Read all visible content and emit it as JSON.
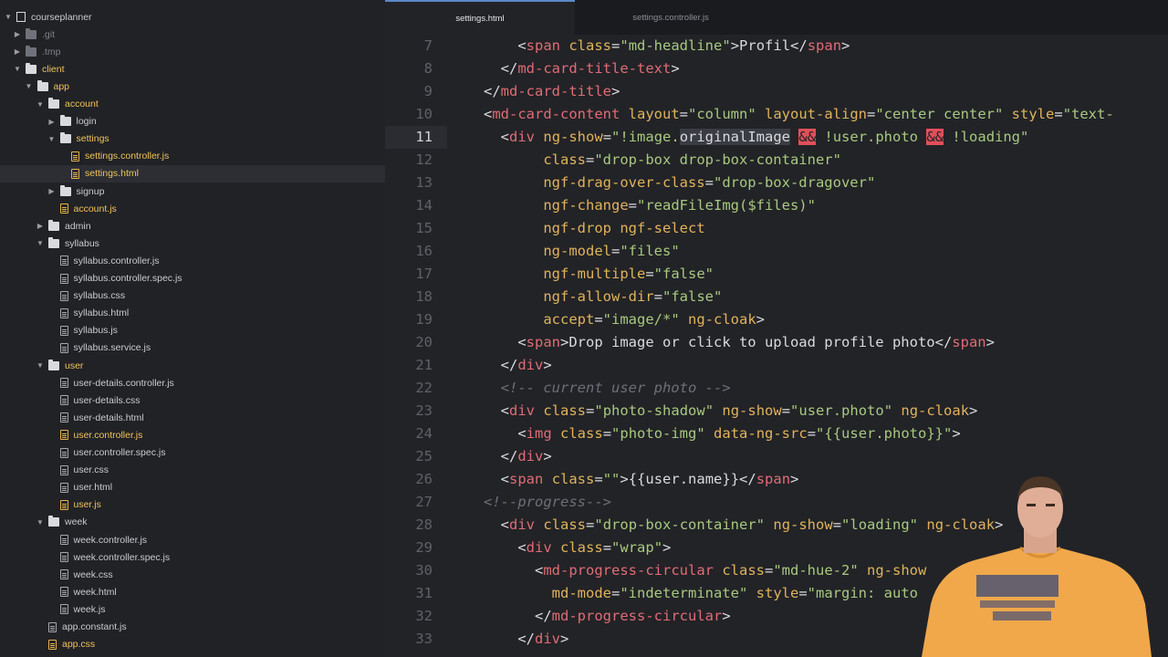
{
  "sidebar": {
    "items": [
      {
        "label": "courseplanner",
        "type": "repo",
        "depth": 0,
        "chev": "down",
        "hl": false,
        "dim": false
      },
      {
        "label": ".git",
        "type": "folder",
        "depth": 1,
        "chev": "right",
        "hl": false,
        "dim": true
      },
      {
        "label": ".tmp",
        "type": "folder",
        "depth": 1,
        "chev": "right",
        "hl": false,
        "dim": true
      },
      {
        "label": "client",
        "type": "folder",
        "depth": 1,
        "chev": "down",
        "hl": true,
        "dim": false
      },
      {
        "label": "app",
        "type": "folder",
        "depth": 2,
        "chev": "down",
        "hl": true,
        "dim": false
      },
      {
        "label": "account",
        "type": "folder",
        "depth": 3,
        "chev": "down",
        "hl": true,
        "dim": false
      },
      {
        "label": "login",
        "type": "folder",
        "depth": 4,
        "chev": "right",
        "hl": false,
        "dim": false
      },
      {
        "label": "settings",
        "type": "folder",
        "depth": 4,
        "chev": "down",
        "hl": true,
        "dim": false
      },
      {
        "label": "settings.controller.js",
        "type": "file",
        "depth": 5,
        "chev": "",
        "hl": true,
        "dim": false
      },
      {
        "label": "settings.html",
        "type": "file",
        "depth": 5,
        "chev": "",
        "hl": true,
        "dim": false,
        "selected": true
      },
      {
        "label": "signup",
        "type": "folder",
        "depth": 4,
        "chev": "right",
        "hl": false,
        "dim": false
      },
      {
        "label": "account.js",
        "type": "file",
        "depth": 4,
        "chev": "",
        "hl": true,
        "dim": false
      },
      {
        "label": "admin",
        "type": "folder",
        "depth": 3,
        "chev": "right",
        "hl": false,
        "dim": false
      },
      {
        "label": "syllabus",
        "type": "folder",
        "depth": 3,
        "chev": "down",
        "hl": false,
        "dim": false
      },
      {
        "label": "syllabus.controller.js",
        "type": "file",
        "depth": 4,
        "chev": "",
        "hl": false,
        "dim": false
      },
      {
        "label": "syllabus.controller.spec.js",
        "type": "file",
        "depth": 4,
        "chev": "",
        "hl": false,
        "dim": false
      },
      {
        "label": "syllabus.css",
        "type": "file",
        "depth": 4,
        "chev": "",
        "hl": false,
        "dim": false
      },
      {
        "label": "syllabus.html",
        "type": "file",
        "depth": 4,
        "chev": "",
        "hl": false,
        "dim": false
      },
      {
        "label": "syllabus.js",
        "type": "file",
        "depth": 4,
        "chev": "",
        "hl": false,
        "dim": false
      },
      {
        "label": "syllabus.service.js",
        "type": "file",
        "depth": 4,
        "chev": "",
        "hl": false,
        "dim": false
      },
      {
        "label": "user",
        "type": "folder",
        "depth": 3,
        "chev": "down",
        "hl": true,
        "dim": false
      },
      {
        "label": "user-details.controller.js",
        "type": "file",
        "depth": 4,
        "chev": "",
        "hl": false,
        "dim": false
      },
      {
        "label": "user-details.css",
        "type": "file",
        "depth": 4,
        "chev": "",
        "hl": false,
        "dim": false
      },
      {
        "label": "user-details.html",
        "type": "file",
        "depth": 4,
        "chev": "",
        "hl": false,
        "dim": false
      },
      {
        "label": "user.controller.js",
        "type": "file",
        "depth": 4,
        "chev": "",
        "hl": true,
        "dim": false
      },
      {
        "label": "user.controller.spec.js",
        "type": "file",
        "depth": 4,
        "chev": "",
        "hl": false,
        "dim": false
      },
      {
        "label": "user.css",
        "type": "file",
        "depth": 4,
        "chev": "",
        "hl": false,
        "dim": false
      },
      {
        "label": "user.html",
        "type": "file",
        "depth": 4,
        "chev": "",
        "hl": false,
        "dim": false
      },
      {
        "label": "user.js",
        "type": "file",
        "depth": 4,
        "chev": "",
        "hl": true,
        "dim": false
      },
      {
        "label": "week",
        "type": "folder",
        "depth": 3,
        "chev": "down",
        "hl": false,
        "dim": false
      },
      {
        "label": "week.controller.js",
        "type": "file",
        "depth": 4,
        "chev": "",
        "hl": false,
        "dim": false
      },
      {
        "label": "week.controller.spec.js",
        "type": "file",
        "depth": 4,
        "chev": "",
        "hl": false,
        "dim": false
      },
      {
        "label": "week.css",
        "type": "file",
        "depth": 4,
        "chev": "",
        "hl": false,
        "dim": false
      },
      {
        "label": "week.html",
        "type": "file",
        "depth": 4,
        "chev": "",
        "hl": false,
        "dim": false
      },
      {
        "label": "week.js",
        "type": "file",
        "depth": 4,
        "chev": "",
        "hl": false,
        "dim": false
      },
      {
        "label": "app.constant.js",
        "type": "file",
        "depth": 3,
        "chev": "",
        "hl": false,
        "dim": false
      },
      {
        "label": "app.css",
        "type": "file",
        "depth": 3,
        "chev": "",
        "hl": true,
        "dim": false
      }
    ]
  },
  "tabs": [
    {
      "label": "settings.html",
      "active": true
    },
    {
      "label": "settings.controller.js",
      "active": false
    }
  ],
  "editor": {
    "current_line": 11,
    "lines": [
      {
        "num": "7",
        "tokens": [
          [
            "t",
            "    "
          ],
          [
            "p",
            "<"
          ],
          [
            "g",
            "span"
          ],
          [
            "t",
            " "
          ],
          [
            "a",
            "class"
          ],
          [
            "p",
            "="
          ],
          [
            "s",
            "\"md-headline\""
          ],
          [
            "p",
            ">"
          ],
          [
            "t",
            "Profil"
          ],
          [
            "p",
            "</"
          ],
          [
            "g",
            "span"
          ],
          [
            "p",
            ">"
          ]
        ]
      },
      {
        "num": "8",
        "tokens": [
          [
            "t",
            "  "
          ],
          [
            "p",
            "</"
          ],
          [
            "g",
            "md-card-title-text"
          ],
          [
            "p",
            ">"
          ]
        ]
      },
      {
        "num": "9",
        "tokens": [
          [
            "p",
            "</"
          ],
          [
            "g",
            "md-card-title"
          ],
          [
            "p",
            ">"
          ]
        ]
      },
      {
        "num": "10",
        "tokens": [
          [
            "p",
            "<"
          ],
          [
            "g",
            "md-card-content"
          ],
          [
            "t",
            " "
          ],
          [
            "a",
            "layout"
          ],
          [
            "p",
            "="
          ],
          [
            "s",
            "\"column\""
          ],
          [
            "t",
            " "
          ],
          [
            "a",
            "layout-align"
          ],
          [
            "p",
            "="
          ],
          [
            "s",
            "\"center center\""
          ],
          [
            "t",
            " "
          ],
          [
            "a",
            "style"
          ],
          [
            "p",
            "="
          ],
          [
            "s",
            "\"text-"
          ]
        ]
      },
      {
        "num": "11",
        "tokens": [
          [
            "t",
            "  "
          ],
          [
            "p",
            "<"
          ],
          [
            "g",
            "div"
          ],
          [
            "t",
            " "
          ],
          [
            "a",
            "ng-show"
          ],
          [
            "p",
            "="
          ],
          [
            "s",
            "\"!image."
          ],
          [
            "sel",
            "originalImage"
          ],
          [
            "t",
            " "
          ],
          [
            "amp",
            "&&"
          ],
          [
            "s",
            " !user.photo "
          ],
          [
            "amp",
            "&&"
          ],
          [
            "s",
            " !loading\""
          ]
        ]
      },
      {
        "num": "12",
        "tokens": [
          [
            "t",
            "       "
          ],
          [
            "a",
            "class"
          ],
          [
            "p",
            "="
          ],
          [
            "s",
            "\"drop-box drop-box-container\""
          ]
        ]
      },
      {
        "num": "13",
        "tokens": [
          [
            "t",
            "       "
          ],
          [
            "a",
            "ngf-drag-over-class"
          ],
          [
            "p",
            "="
          ],
          [
            "s",
            "\"drop-box-dragover\""
          ]
        ]
      },
      {
        "num": "14",
        "tokens": [
          [
            "t",
            "       "
          ],
          [
            "a",
            "ngf-change"
          ],
          [
            "p",
            "="
          ],
          [
            "s",
            "\"readFileImg($files)\""
          ]
        ]
      },
      {
        "num": "15",
        "tokens": [
          [
            "t",
            "       "
          ],
          [
            "a",
            "ngf-drop ngf-select"
          ]
        ]
      },
      {
        "num": "16",
        "tokens": [
          [
            "t",
            "       "
          ],
          [
            "a",
            "ng-model"
          ],
          [
            "p",
            "="
          ],
          [
            "s",
            "\"files\""
          ]
        ]
      },
      {
        "num": "17",
        "tokens": [
          [
            "t",
            "       "
          ],
          [
            "a",
            "ngf-multiple"
          ],
          [
            "p",
            "="
          ],
          [
            "s",
            "\"false\""
          ]
        ]
      },
      {
        "num": "18",
        "tokens": [
          [
            "t",
            "       "
          ],
          [
            "a",
            "ngf-allow-dir"
          ],
          [
            "p",
            "="
          ],
          [
            "s",
            "\"false\""
          ]
        ]
      },
      {
        "num": "19",
        "tokens": [
          [
            "t",
            "       "
          ],
          [
            "a",
            "accept"
          ],
          [
            "p",
            "="
          ],
          [
            "s",
            "\"image/*\""
          ],
          [
            "t",
            " "
          ],
          [
            "a",
            "ng-cloak"
          ],
          [
            "p",
            ">"
          ]
        ]
      },
      {
        "num": "20",
        "tokens": [
          [
            "t",
            "    "
          ],
          [
            "p",
            "<"
          ],
          [
            "g",
            "span"
          ],
          [
            "p",
            ">"
          ],
          [
            "t",
            "Drop image or click to upload profile photo"
          ],
          [
            "p",
            "</"
          ],
          [
            "g",
            "span"
          ],
          [
            "p",
            ">"
          ]
        ]
      },
      {
        "num": "21",
        "tokens": [
          [
            "t",
            "  "
          ],
          [
            "p",
            "</"
          ],
          [
            "g",
            "div"
          ],
          [
            "p",
            ">"
          ]
        ]
      },
      {
        "num": "22",
        "tokens": [
          [
            "t",
            "  "
          ],
          [
            "c",
            "<!-- current user photo -->"
          ]
        ]
      },
      {
        "num": "23",
        "tokens": [
          [
            "t",
            "  "
          ],
          [
            "p",
            "<"
          ],
          [
            "g",
            "div"
          ],
          [
            "t",
            " "
          ],
          [
            "a",
            "class"
          ],
          [
            "p",
            "="
          ],
          [
            "s",
            "\"photo-shadow\""
          ],
          [
            "t",
            " "
          ],
          [
            "a",
            "ng-show"
          ],
          [
            "p",
            "="
          ],
          [
            "s",
            "\"user.photo\""
          ],
          [
            "t",
            " "
          ],
          [
            "a",
            "ng-cloak"
          ],
          [
            "p",
            ">"
          ]
        ]
      },
      {
        "num": "24",
        "tokens": [
          [
            "t",
            "    "
          ],
          [
            "p",
            "<"
          ],
          [
            "g",
            "img"
          ],
          [
            "t",
            " "
          ],
          [
            "a",
            "class"
          ],
          [
            "p",
            "="
          ],
          [
            "s",
            "\"photo-img\""
          ],
          [
            "t",
            " "
          ],
          [
            "a",
            "data-ng-src"
          ],
          [
            "p",
            "="
          ],
          [
            "s",
            "\"{{user.photo}}\""
          ],
          [
            "p",
            ">"
          ]
        ]
      },
      {
        "num": "25",
        "tokens": [
          [
            "t",
            "  "
          ],
          [
            "p",
            "</"
          ],
          [
            "g",
            "div"
          ],
          [
            "p",
            ">"
          ]
        ]
      },
      {
        "num": "26",
        "tokens": [
          [
            "t",
            "  "
          ],
          [
            "p",
            "<"
          ],
          [
            "g",
            "span"
          ],
          [
            "t",
            " "
          ],
          [
            "a",
            "class"
          ],
          [
            "p",
            "="
          ],
          [
            "s",
            "\"\""
          ],
          [
            "p",
            ">"
          ],
          [
            "t",
            "{{user.name}}"
          ],
          [
            "p",
            "</"
          ],
          [
            "g",
            "span"
          ],
          [
            "p",
            ">"
          ]
        ]
      },
      {
        "num": "27",
        "tokens": [
          [
            "c",
            "<!--progress-->"
          ]
        ]
      },
      {
        "num": "28",
        "tokens": [
          [
            "t",
            "  "
          ],
          [
            "p",
            "<"
          ],
          [
            "g",
            "div"
          ],
          [
            "t",
            " "
          ],
          [
            "a",
            "class"
          ],
          [
            "p",
            "="
          ],
          [
            "s",
            "\"drop-box-container\""
          ],
          [
            "t",
            " "
          ],
          [
            "a",
            "ng-show"
          ],
          [
            "p",
            "="
          ],
          [
            "s",
            "\"loading\""
          ],
          [
            "t",
            " "
          ],
          [
            "a",
            "ng-cloak"
          ],
          [
            "p",
            ">"
          ]
        ]
      },
      {
        "num": "29",
        "tokens": [
          [
            "t",
            "    "
          ],
          [
            "p",
            "<"
          ],
          [
            "g",
            "div"
          ],
          [
            "t",
            " "
          ],
          [
            "a",
            "class"
          ],
          [
            "p",
            "="
          ],
          [
            "s",
            "\"wrap\""
          ],
          [
            "p",
            ">"
          ]
        ]
      },
      {
        "num": "30",
        "tokens": [
          [
            "t",
            "      "
          ],
          [
            "p",
            "<"
          ],
          [
            "g",
            "md-progress-circular"
          ],
          [
            "t",
            " "
          ],
          [
            "a",
            "class"
          ],
          [
            "p",
            "="
          ],
          [
            "s",
            "\"md-hue-2\""
          ],
          [
            "t",
            " "
          ],
          [
            "a",
            "ng-show"
          ]
        ]
      },
      {
        "num": "31",
        "tokens": [
          [
            "t",
            "        "
          ],
          [
            "a",
            "md-mode"
          ],
          [
            "p",
            "="
          ],
          [
            "s",
            "\"indeterminate\""
          ],
          [
            "t",
            " "
          ],
          [
            "a",
            "style"
          ],
          [
            "p",
            "="
          ],
          [
            "s",
            "\"margin: auto"
          ]
        ]
      },
      {
        "num": "32",
        "tokens": [
          [
            "t",
            "      "
          ],
          [
            "p",
            "</"
          ],
          [
            "g",
            "md-progress-circular"
          ],
          [
            "p",
            ">"
          ]
        ]
      },
      {
        "num": "33",
        "tokens": [
          [
            "t",
            "    "
          ],
          [
            "p",
            "</"
          ],
          [
            "g",
            "div"
          ],
          [
            "p",
            ">"
          ]
        ]
      }
    ]
  },
  "colors": {
    "accent": "#5b89c7",
    "tag": "#e06c75",
    "attribute": "#e0b35b",
    "string": "#a8c97f",
    "highlight_file": "#f0c35a"
  }
}
